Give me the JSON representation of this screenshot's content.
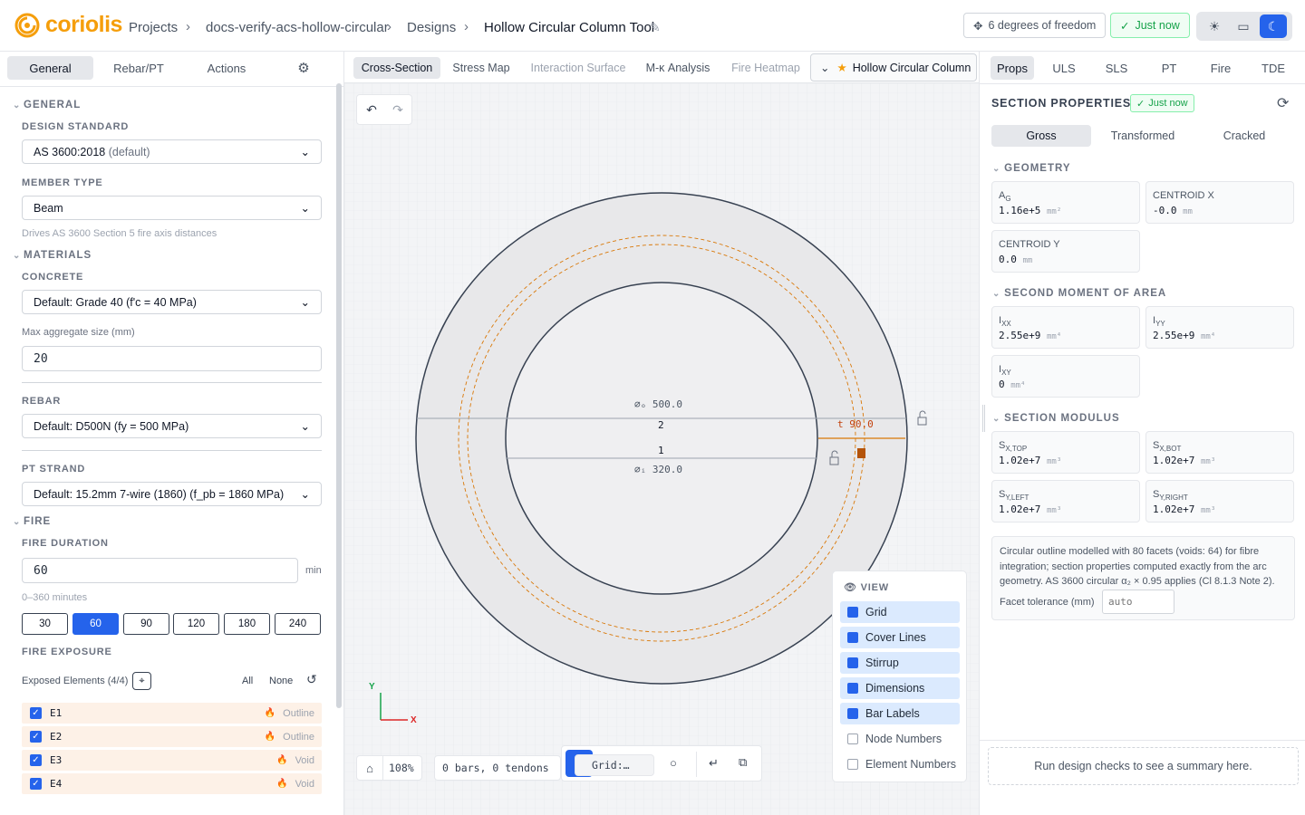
{
  "header": {
    "logo_text": "coriolis",
    "breadcrumbs": [
      "Projects",
      "docs-verify-acs-hollow-circular",
      "Designs",
      "Hollow Circular Column Tool"
    ],
    "dof_label": "6 degrees of freedom",
    "saved_label": "Just now"
  },
  "left": {
    "tabs": [
      "General",
      "Rebar/PT",
      "Actions"
    ],
    "general_title": "GENERAL",
    "design_standard_label": "DESIGN STANDARD",
    "design_standard_value": "AS 3600:2018",
    "design_standard_suffix": "(default)",
    "member_type_label": "MEMBER TYPE",
    "member_type_value": "Beam",
    "member_type_hint": "Drives AS 3600 Section 5 fire axis distances",
    "materials_title": "MATERIALS",
    "concrete_label": "CONCRETE",
    "concrete_value": "Default: Grade 40 (f'c = 40 MPa)",
    "agg_label": "Max aggregate size (mm)",
    "agg_value": "20",
    "rebar_label": "REBAR",
    "rebar_value": "Default: D500N (fy = 500 MPa)",
    "pt_label": "PT STRAND",
    "pt_value": "Default: 15.2mm 7-wire (1860) (f_pb = 1860 MPa)",
    "fire_title": "FIRE",
    "fire_duration_label": "FIRE DURATION",
    "fire_duration_value": "60",
    "fire_duration_unit": "min",
    "fire_duration_range": "0–360 minutes",
    "durations": [
      "30",
      "60",
      "90",
      "120",
      "180",
      "240"
    ],
    "fire_exposure_label": "FIRE EXPOSURE",
    "exposed_label": "Exposed Elements (4/4)",
    "all_label": "All",
    "none_label": "None",
    "elements": [
      {
        "name": "E1",
        "type": "Outline"
      },
      {
        "name": "E2",
        "type": "Outline"
      },
      {
        "name": "E3",
        "type": "Void"
      },
      {
        "name": "E4",
        "type": "Void"
      }
    ]
  },
  "canvas": {
    "tabs": [
      "Cross-Section",
      "Stress Map",
      "Interaction Surface",
      "M-κ Analysis",
      "Fire Heatmap"
    ],
    "design_name": "Hollow Circular Column",
    "dim_outer": "⌀ₒ 500.0",
    "dim_inner": "⌀ᵢ 320.0",
    "dim_thickness": "t 90.0",
    "label_2": "2",
    "label_1": "1",
    "axis_y": "Y",
    "axis_x": "X",
    "zoom": "108%",
    "bars_tendons": "0 bars, 0 tendons",
    "grid_select": "Grid:…",
    "view_title": "VIEW",
    "view_items": [
      {
        "label": "Grid",
        "on": true
      },
      {
        "label": "Cover Lines",
        "on": true
      },
      {
        "label": "Stirrup",
        "on": true
      },
      {
        "label": "Dimensions",
        "on": true
      },
      {
        "label": "Bar Labels",
        "on": true
      },
      {
        "label": "Node Numbers",
        "on": false
      },
      {
        "label": "Element Numbers",
        "on": false
      }
    ]
  },
  "right": {
    "tabs": [
      "Props",
      "ULS",
      "SLS",
      "PT",
      "Fire",
      "TDE"
    ],
    "title": "SECTION PROPERTIES",
    "saved_badge": "Just now",
    "subtabs": [
      "Gross",
      "Transformed",
      "Cracked"
    ],
    "geometry_title": "GEOMETRY",
    "second_moment_title": "SECOND MOMENT OF AREA",
    "modulus_title": "SECTION MODULUS",
    "cards": {
      "ag": {
        "value": "1.16e+5",
        "unit": "mm²"
      },
      "cx": {
        "label": "CENTROID X",
        "value": "-0.0",
        "unit": "mm"
      },
      "cy": {
        "label": "CENTROID Y",
        "value": "0.0",
        "unit": "mm"
      },
      "ixx": {
        "value": "2.55e+9",
        "unit": "mm⁴"
      },
      "iyy": {
        "value": "2.55e+9",
        "unit": "mm⁴"
      },
      "ixy": {
        "value": "0",
        "unit": "mm⁴"
      },
      "sxtop": {
        "value": "1.02e+7",
        "unit": "mm³"
      },
      "sxbot": {
        "value": "1.02e+7",
        "unit": "mm³"
      },
      "syleft": {
        "value": "1.02e+7",
        "unit": "mm³"
      },
      "syright": {
        "value": "1.02e+7",
        "unit": "mm³"
      }
    },
    "note": "Circular outline modelled with 80 facets (voids: 64) for fibre integration; section properties computed exactly from the arc geometry. AS 3600 circular α₂ × 0.95 applies (Cl 8.1.3 Note 2).",
    "facet_label": "Facet tolerance (mm)",
    "facet_placeholder": "auto",
    "summary": "Run design checks to see a summary here."
  },
  "colors": {
    "accent": "#2563eb",
    "brand": "#f59e0b",
    "dimension_orange": "#c2410c"
  }
}
